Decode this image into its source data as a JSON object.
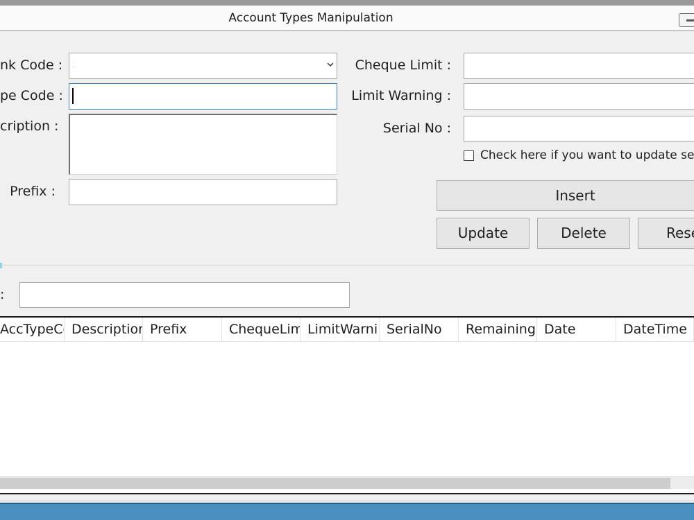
{
  "window": {
    "title": "Account Types Manipulation"
  },
  "form": {
    "bank_code_label": "nk Code :",
    "type_code_label": "pe Code :",
    "description_label": "cription :",
    "prefix_label": "Prefix :",
    "cheque_limit_label": "Cheque Limit :",
    "limit_warning_label": "Limit Warning :",
    "serial_no_label": "Serial No :",
    "update_serial_checkbox_label": "Check here if you want to update serial",
    "bank_code_value": ".",
    "type_code_value": "",
    "description_value": "",
    "prefix_value": "",
    "cheque_limit_value": "",
    "limit_warning_value": "",
    "serial_no_value": ""
  },
  "buttons": {
    "insert": "Insert",
    "update": "Update",
    "delete": "Delete",
    "reset": "Rese"
  },
  "search": {
    "label": ":",
    "value": ""
  },
  "grid": {
    "columns": [
      "AccTypeCo",
      "Descriptior",
      "Prefix",
      "ChequeLim",
      "LimitWarni",
      "SerialNo",
      "Remaining(",
      "Date",
      "DateTime"
    ],
    "rows": []
  },
  "colors": {
    "accent": "#3c7fb1",
    "taskbar": "#4a8fc0"
  },
  "icons": {
    "dropdown": "chevron-down-icon",
    "minimize": "minimize-icon"
  }
}
